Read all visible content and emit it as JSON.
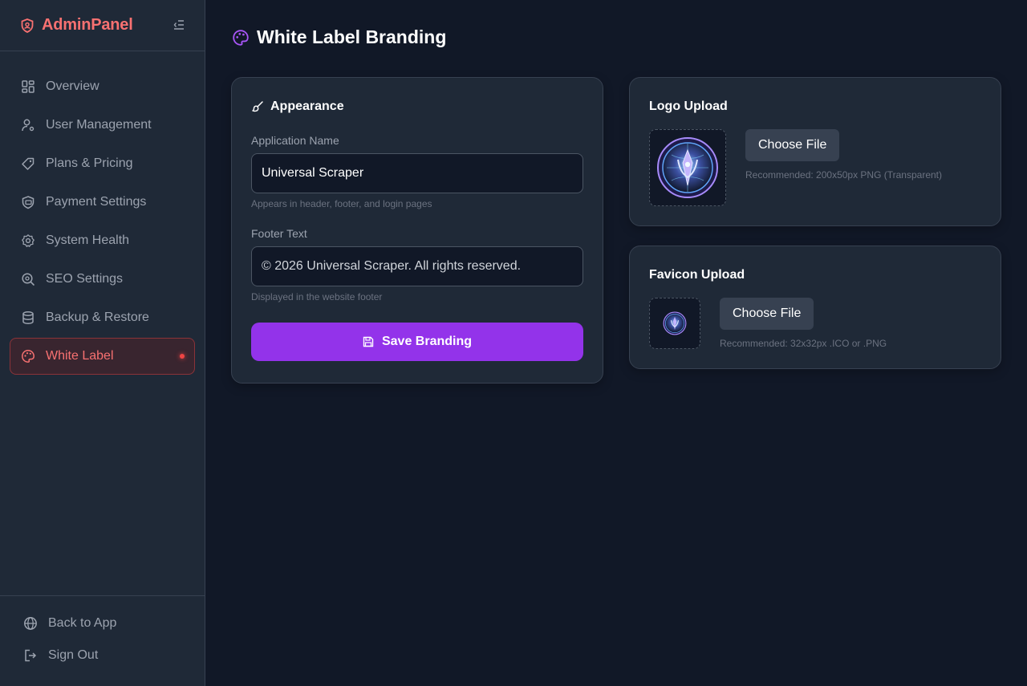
{
  "brand": {
    "name": "AdminPanel",
    "accent": "#f87171"
  },
  "sidebar": {
    "items": [
      {
        "label": "Overview",
        "icon": "grid-icon"
      },
      {
        "label": "User Management",
        "icon": "user-gear-icon"
      },
      {
        "label": "Plans & Pricing",
        "icon": "tag-icon"
      },
      {
        "label": "Payment Settings",
        "icon": "card-icon"
      },
      {
        "label": "System Health",
        "icon": "cog-icon"
      },
      {
        "label": "SEO Settings",
        "icon": "search-icon"
      },
      {
        "label": "Backup & Restore",
        "icon": "database-icon"
      },
      {
        "label": "White Label",
        "icon": "palette-icon",
        "active": true
      }
    ],
    "footer": [
      {
        "label": "Back to App",
        "icon": "globe-icon"
      },
      {
        "label": "Sign Out",
        "icon": "sign-out-icon"
      }
    ]
  },
  "page": {
    "title": "White Label Branding"
  },
  "appearance": {
    "title": "Appearance",
    "app_name": {
      "label": "Application Name",
      "value": "Universal Scraper",
      "hint": "Appears in header, footer, and login pages"
    },
    "footer_text": {
      "label": "Footer Text",
      "value": "© 2026 Universal Scraper. All rights reserved.",
      "hint": "Displayed in the website footer"
    },
    "save_label": "Save Branding",
    "save_color": "#9333ea"
  },
  "logo_upload": {
    "title": "Logo Upload",
    "button": "Choose File",
    "recommendation": "Recommended: 200x50px PNG (Transparent)"
  },
  "favicon_upload": {
    "title": "Favicon Upload",
    "button": "Choose File",
    "recommendation": "Recommended: 32x32px .ICO or .PNG"
  }
}
